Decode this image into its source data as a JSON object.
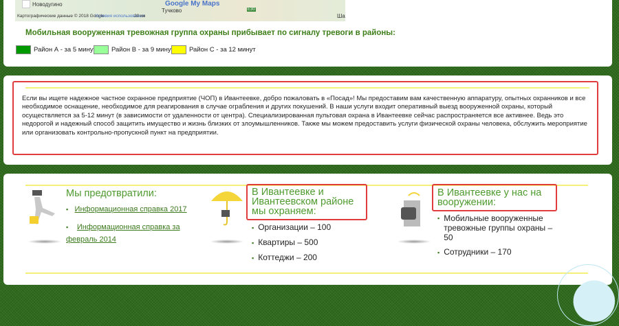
{
  "map": {
    "place1": "Новодугино",
    "place2": "Тучково",
    "place3": "Шатур",
    "road": "E30",
    "attribution": "Картографические данные © 2018 Google",
    "terms": "Условия использования",
    "scale": "20 км",
    "brand": "Google My Maps"
  },
  "legend": {
    "title": "Мобильная вооруженная тревожная группа охраны прибывает по сигналу тревоги в районы:",
    "items": [
      {
        "label": "Район А - за 5 минут",
        "color": "#009900"
      },
      {
        "label": "Район В - за 9 минут",
        "color": "#99ff99"
      },
      {
        "label": "Район С - за 12 минут",
        "color": "#ffff00"
      }
    ]
  },
  "intro": "Если вы ищете надежное частное охранное предприятие (ЧОП) в Ивантеевке, добро пожаловать в «Посад»! Мы предоставим вам качественную аппаратуру, опытных охранников и все необходимое оснащение, необходимое для реагирования в случае ограбления и других покушений. В наши услуги входит оперативный выезд вооруженной охраны, который осуществляется за 5-12 минут (в зависимости от удаленности от центра). Специализированная пультовая охрана в Ивантеевке сейчас распространяется все активнее. Ведь это недорогой и надежный способ защитить имущество и жизнь близких от злоумышленников. Также мы можем предоставить услуги физической охраны человека, обслужить мероприятие или организовать контрольно-пропускной пункт на предприятии.",
  "col1": {
    "title": "Мы предотвратили:",
    "links": [
      "Информационная справка 2017",
      "Информационная справка за февраль 2014"
    ]
  },
  "col2": {
    "title": "В Ивантеевке и Ивантеевском районе мы охраняем:",
    "items": [
      "Организации – 100",
      "Квартиры – 500",
      "Коттеджи – 200"
    ]
  },
  "col3": {
    "title": "В Ивантеевке у нас на вооружении:",
    "items": [
      "Мобильные вооруженные тревожные группы охраны – 50",
      "Сотрудники – 170"
    ]
  }
}
